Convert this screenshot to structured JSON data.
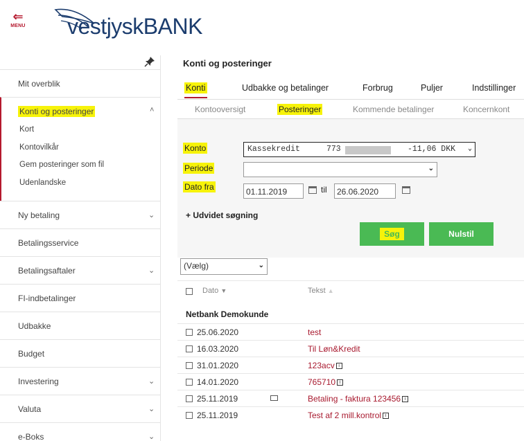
{
  "header": {
    "menu_label": "MENU",
    "logo_text": "vestjyskBANK",
    "brand_color": "#b5192e",
    "logo_color": "#1c3d6e"
  },
  "sidebar": {
    "items": [
      {
        "label": "Mit overblik"
      },
      {
        "label": "Konti og posteringer",
        "sub": [
          "Kort",
          "Kontovilkår",
          "Gem posteringer som fil",
          "Udenlandske"
        ]
      },
      {
        "label": "Ny betaling"
      },
      {
        "label": "Betalingsservice"
      },
      {
        "label": "Betalingsaftaler"
      },
      {
        "label": "FI-indbetalinger"
      },
      {
        "label": "Udbakke"
      },
      {
        "label": "Budget"
      },
      {
        "label": "Investering"
      },
      {
        "label": "Valuta"
      },
      {
        "label": "e-Boks"
      }
    ]
  },
  "main": {
    "title": "Konti og posteringer",
    "tabs": [
      "Konti",
      "Udbakke og betalinger",
      "Forbrug",
      "Puljer",
      "Indstillinger"
    ],
    "subtabs": [
      "Kontooversigt",
      "Posteringer",
      "Kommende betalinger",
      "Koncernkont"
    ],
    "form": {
      "konto_label": "Konto",
      "konto_value_name": "Kassekredit",
      "konto_value_num": "773",
      "konto_value_amount": "-11,06 DKK",
      "periode_label": "Periode",
      "periode_value": "",
      "dato_fra_label": "Dato fra",
      "dato_fra_value": "01.11.2019",
      "til_label": "til",
      "dato_til_value": "26.06.2020",
      "expand_label": "+ Udvidet søgning",
      "search_button": "Søg",
      "reset_button": "Nulstil"
    },
    "action_select": "(Vælg)",
    "table": {
      "col_dato": "Dato",
      "col_tekst": "Tekst",
      "group": "Netbank Demokunde",
      "rows": [
        {
          "date": "25.06.2020",
          "text": "test",
          "info": false,
          "mail": false
        },
        {
          "date": "16.03.2020",
          "text": "Til Løn&Kredit",
          "info": false,
          "mail": false
        },
        {
          "date": "31.01.2020",
          "text": "123acv",
          "info": true,
          "mail": false
        },
        {
          "date": "14.01.2020",
          "text": "765710",
          "info": true,
          "mail": false
        },
        {
          "date": "25.11.2019",
          "text": "Betaling - faktura 123456",
          "info": true,
          "mail": true
        },
        {
          "date": "25.11.2019",
          "text": "Test af 2 mill.kontrol",
          "info": true,
          "mail": false
        }
      ]
    }
  }
}
